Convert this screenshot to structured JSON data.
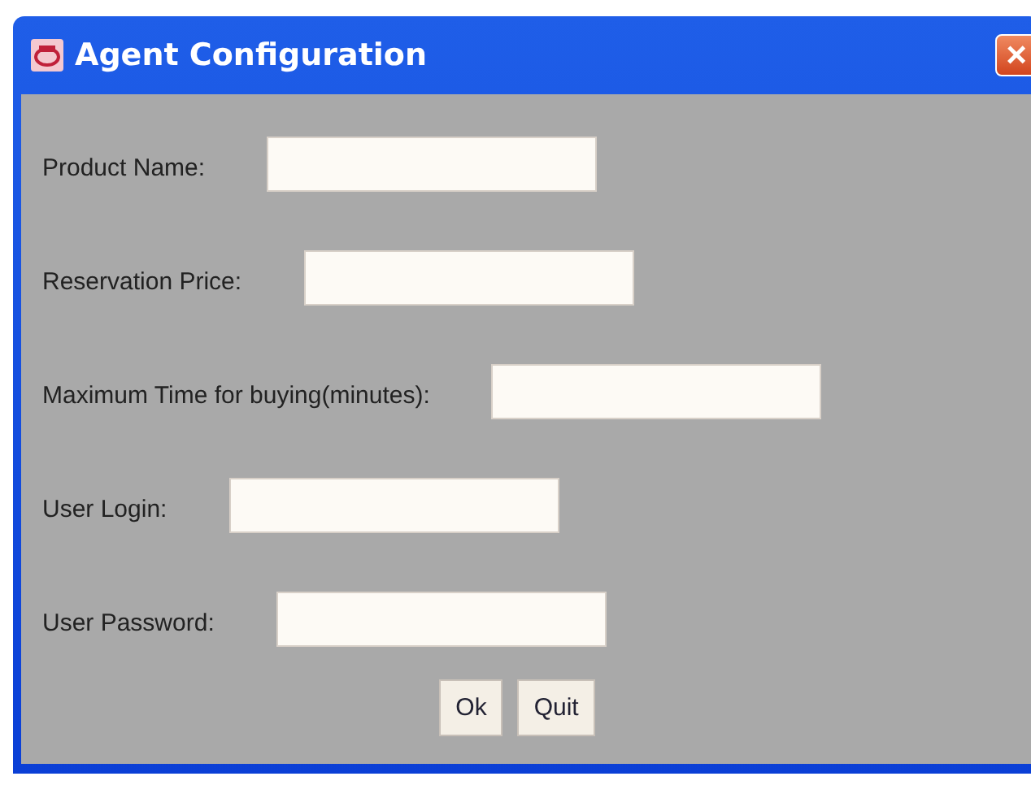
{
  "window": {
    "title": "Agent Configuration",
    "close": "×"
  },
  "fields": [
    {
      "label": "Product Name:"
    },
    {
      "label": "Reservation Price:"
    },
    {
      "label": "Maximum Time for buying(minutes):"
    },
    {
      "label": "User Login:"
    },
    {
      "label": "User Password:"
    }
  ],
  "buttons": [
    "Ok",
    "Quit"
  ]
}
